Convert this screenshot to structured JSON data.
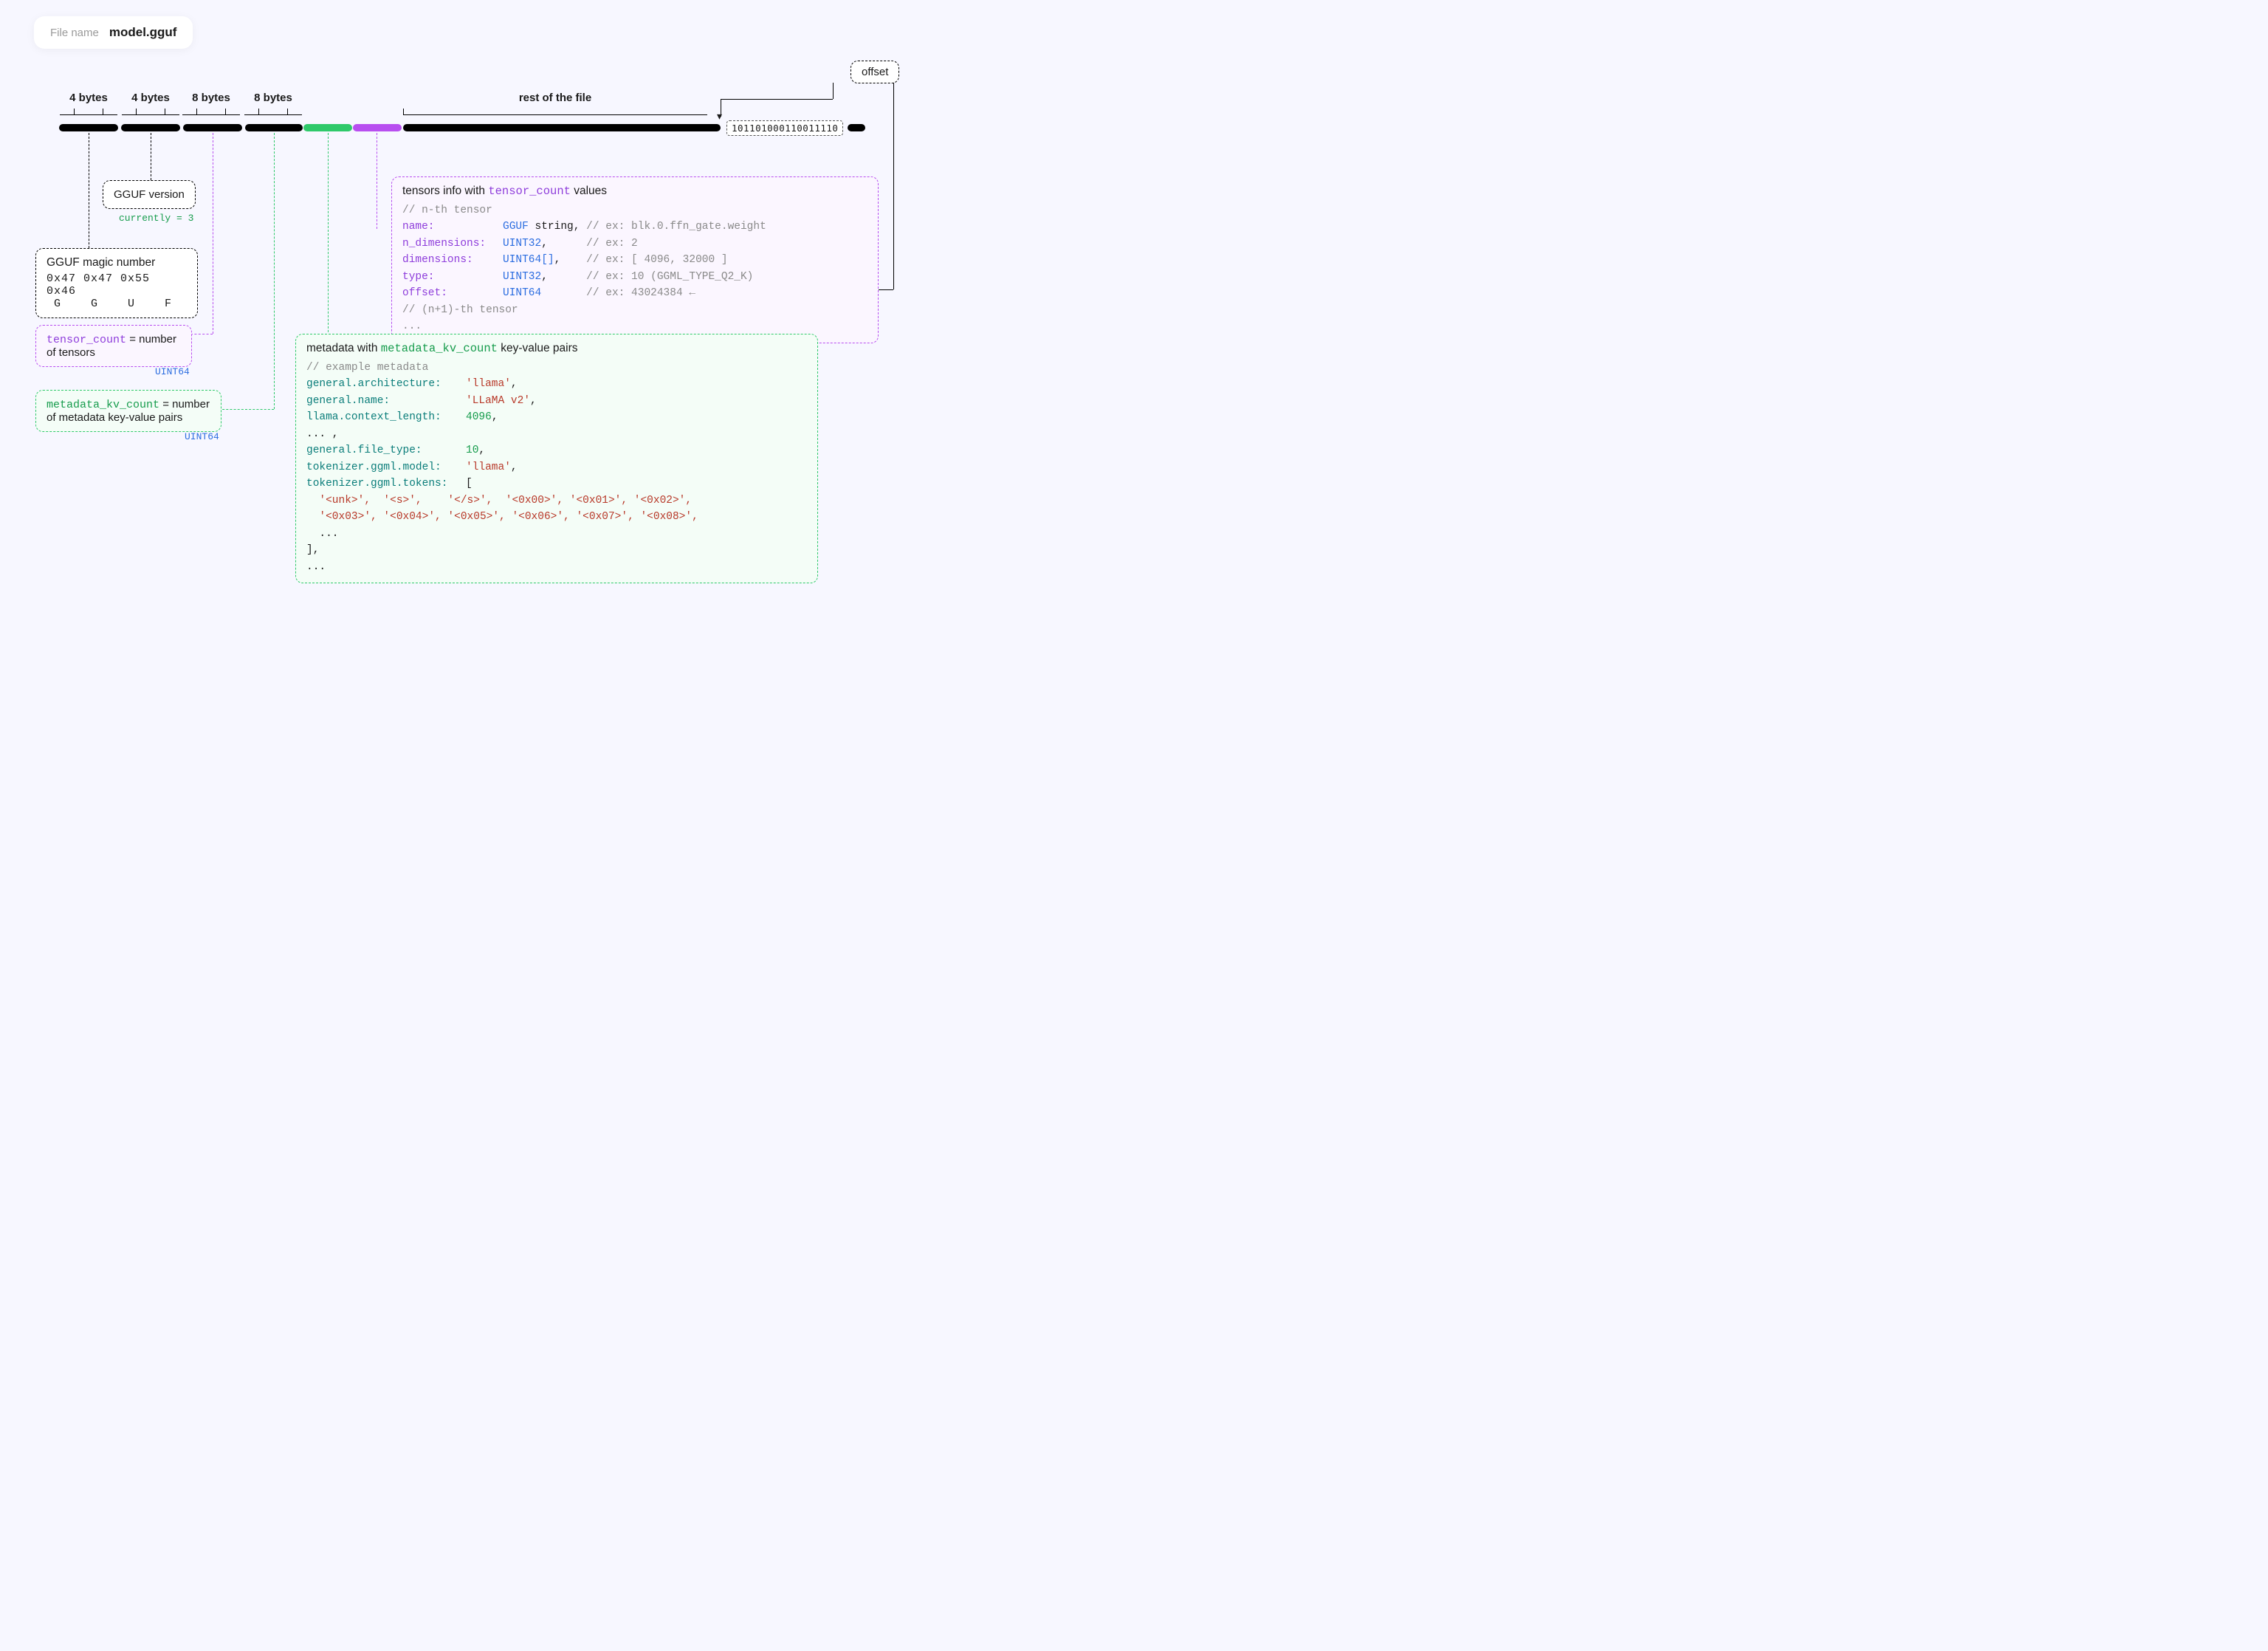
{
  "file": {
    "label": "File name",
    "value": "model.gguf"
  },
  "ruler": {
    "seg1": "4 bytes",
    "seg2": "4 bytes",
    "seg3": "8 bytes",
    "seg4": "8 bytes",
    "rest": "rest of the file"
  },
  "offset_chip": "offset",
  "offset_binary": "101101000110011110",
  "magic": {
    "title": "GGUF magic number",
    "hex": "0x47 0x47 0x55 0x46",
    "letters": "G    G    U    F"
  },
  "version": {
    "title": "GGUF version",
    "note_pre": "currently = ",
    "note_val": "3"
  },
  "tensor_count": {
    "var": "tensor_count",
    "rest": " = number of tensors",
    "type": "UINT64"
  },
  "kv_count": {
    "var": "metadata_kv_count",
    "rest": " = number of metadata key-value pairs",
    "type": "UINT64"
  },
  "tensors_panel": {
    "hdr_pre": "tensors info with ",
    "hdr_var": "tensor_count",
    "hdr_post": " values",
    "c0": "// n-th tensor",
    "rows": [
      {
        "k": "name:",
        "t": "GGUF",
        "extra": " string,",
        "cm": "// ex: blk.0.ffn_gate.weight"
      },
      {
        "k": "n_dimensions:",
        "t": "UINT32",
        "extra": ",",
        "cm": "// ex: 2"
      },
      {
        "k": "dimensions:",
        "t": "UINT64[]",
        "extra": ",",
        "cm": "// ex: [ 4096, 32000 ]"
      },
      {
        "k": "type:",
        "t": "UINT32",
        "extra": ",",
        "cm": "// ex: 10 (GGML_TYPE_Q2_K)"
      },
      {
        "k": "offset:",
        "t": "UINT64",
        "extra": "",
        "cm": "// ex: 43024384 ←"
      }
    ],
    "c_end1": "// (n+1)-th tensor",
    "c_end2": "..."
  },
  "metadata_panel": {
    "hdr_pre": "metadata with ",
    "hdr_var": "metadata_kv_count",
    "hdr_post": " key-value pairs",
    "c0": "// example metadata",
    "lines": {
      "arch_k": "general.architecture:",
      "arch_v": "'llama'",
      "name_k": "general.name:",
      "name_v": "'LLaMA v2'",
      "ctx_k": "llama.context_length:",
      "ctx_v": "4096",
      "dots1": "... ,",
      "ft_k": "general.file_type:",
      "ft_v": "10",
      "tm_k": "tokenizer.ggml.model:",
      "tm_v": "'llama'",
      "tt_k": "tokenizer.ggml.tokens:",
      "tt_v": "[",
      "toks1": "  '<unk>',  '<s>',    '</s>',  '<0x00>', '<0x01>', '<0x02>',",
      "toks2": "  '<0x03>', '<0x04>', '<0x05>', '<0x06>', '<0x07>', '<0x08>',",
      "toks3": "  ...",
      "close": "],",
      "dots2": "..."
    }
  }
}
